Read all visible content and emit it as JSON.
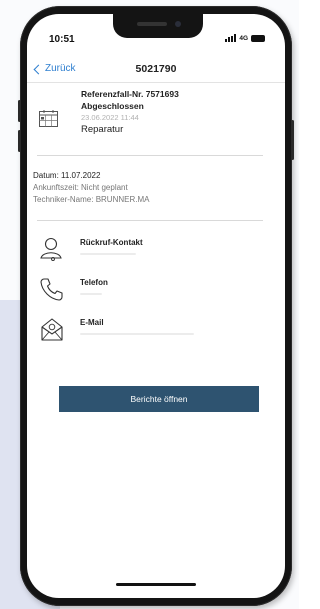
{
  "status_bar": {
    "time": "10:51",
    "network": "4G"
  },
  "header": {
    "back_label": "Zurück",
    "title": "5021790"
  },
  "reference": {
    "number": "Referenzfall-Nr. 7571693",
    "status": "Abgeschlossen",
    "date": "23.06.2022 11:44",
    "type": "Reparatur"
  },
  "details": {
    "date": "Datum: 11.07.2022",
    "arrival": "Ankunftszeit: Nicht geplant",
    "technician": "Techniker-Name: BRUNNER.MA"
  },
  "contacts": [
    {
      "label": "Rückruf-Kontakt",
      "icon": "person-icon"
    },
    {
      "label": "Telefon",
      "icon": "phone-icon"
    },
    {
      "label": "E-Mail",
      "icon": "mail-icon"
    }
  ],
  "action": {
    "reports_button": "Berichte öffnen"
  },
  "colors": {
    "accent": "#2f7fd0",
    "button": "#2e5370",
    "panel": "#dfe3f1"
  }
}
